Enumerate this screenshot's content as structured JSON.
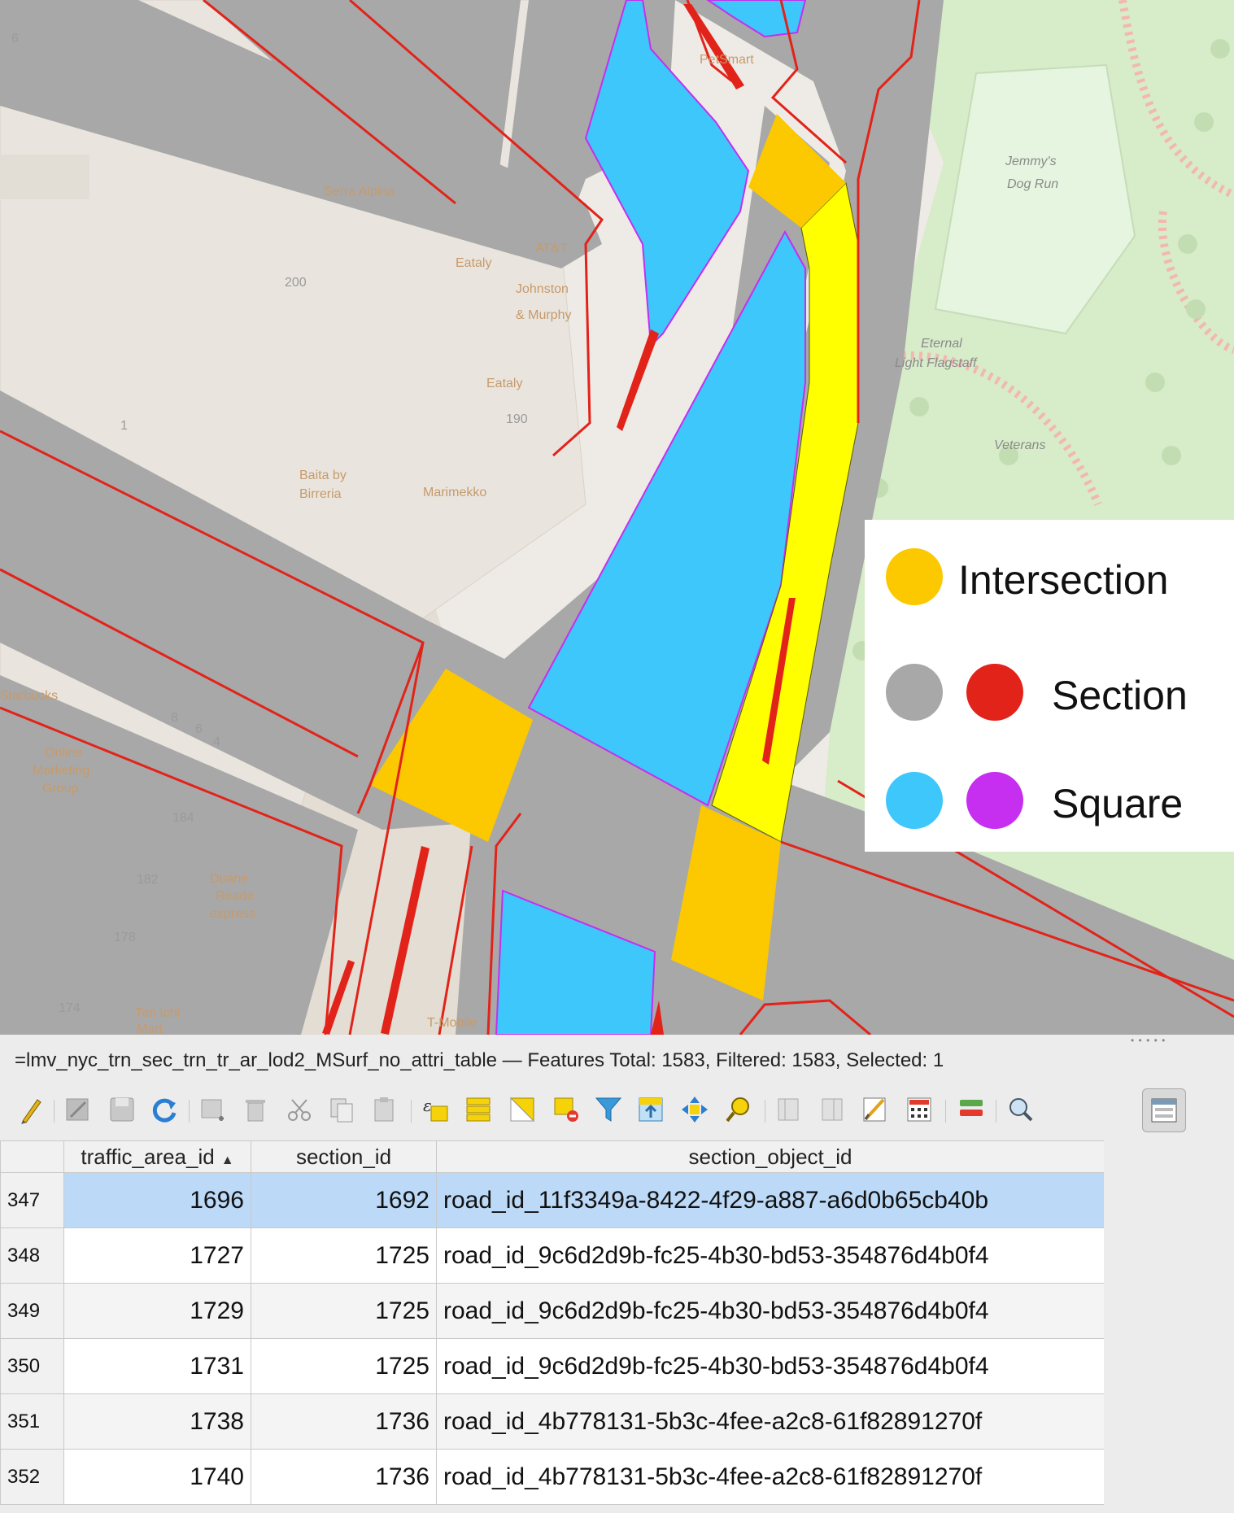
{
  "map": {
    "poi_labels": [
      "PetSmart",
      "Serra Alpina",
      "Eataly",
      "AT&T",
      "Johnston",
      "& Murphy",
      "Eataly",
      "Baita by",
      "Birreria",
      "Marimekko",
      "Starbucks",
      "Online",
      "Marketing",
      "Group",
      "Duane",
      "Reade",
      "express",
      "Ten Ichi",
      "Mart",
      "T-Mobile",
      "Jemmy's",
      "Dog Run",
      "Eternal",
      "Light Flagstaff",
      "Veterans"
    ],
    "building_numbers": [
      "6",
      "200",
      "1",
      "190",
      "8",
      "6",
      "4",
      "184",
      "182",
      "178",
      "174"
    ],
    "colors": {
      "intersection": "#fcc800",
      "section_fill": "#a8a8a8",
      "section_edge": "#e2231a",
      "square_fill": "#3dc7fb",
      "square_edge": "#c62ef0",
      "highlight": "#ffff00",
      "basemap_land": "#eeebe6",
      "basemap_building": "#ddd6cc",
      "park": "#d7ecc9"
    }
  },
  "legend": {
    "items": [
      {
        "label": "Intersection",
        "icons": [
          "intersection-fill"
        ]
      },
      {
        "label": "Section",
        "icons": [
          "section-fill",
          "section-edge"
        ]
      },
      {
        "label": "Square",
        "icons": [
          "square-fill",
          "square-edge"
        ]
      }
    ]
  },
  "attribute_table": {
    "title": "=lmv_nyc_trn_sec_trn_tr_ar_lod2_MSurf_no_attri_table — Features Total: 1583, Filtered: 1583, Selected: 1",
    "toolbar": [
      "toggle-editing-icon",
      "multi-edit-icon",
      "save-edits-icon",
      "reload-icon",
      "add-feature-icon",
      "delete-feature-icon",
      "cut-icon",
      "copy-icon",
      "paste-icon",
      "select-by-expression-icon",
      "select-all-icon",
      "invert-selection-icon",
      "deselect-all-icon",
      "filter-icon",
      "move-selection-to-top-icon",
      "pan-to-selection-icon",
      "zoom-to-selection-icon",
      "new-field-icon",
      "delete-field-icon",
      "field-calculator-icon",
      "conditional-formatting-icon",
      "actions-icon",
      "dock-table-icon",
      "form-view-icon"
    ],
    "columns": [
      "traffic_area_id",
      "section_id",
      "section_object_id"
    ],
    "sorted_column": "traffic_area_id",
    "rows": [
      {
        "row": "347",
        "traffic_area_id": "1696",
        "section_id": "1692",
        "section_object_id": "road_id_11f3349a-8422-4f29-a887-a6d0b65cb40b",
        "selected": true
      },
      {
        "row": "348",
        "traffic_area_id": "1727",
        "section_id": "1725",
        "section_object_id": "road_id_9c6d2d9b-fc25-4b30-bd53-354876d4b0f4",
        "selected": false
      },
      {
        "row": "349",
        "traffic_area_id": "1729",
        "section_id": "1725",
        "section_object_id": "road_id_9c6d2d9b-fc25-4b30-bd53-354876d4b0f4",
        "selected": false
      },
      {
        "row": "350",
        "traffic_area_id": "1731",
        "section_id": "1725",
        "section_object_id": "road_id_9c6d2d9b-fc25-4b30-bd53-354876d4b0f4",
        "selected": false
      },
      {
        "row": "351",
        "traffic_area_id": "1738",
        "section_id": "1736",
        "section_object_id": "road_id_4b778131-5b3c-4fee-a2c8-61f82891270f",
        "selected": false
      },
      {
        "row": "352",
        "traffic_area_id": "1740",
        "section_id": "1736",
        "section_object_id": "road_id_4b778131-5b3c-4fee-a2c8-61f82891270f",
        "selected": false
      }
    ]
  }
}
